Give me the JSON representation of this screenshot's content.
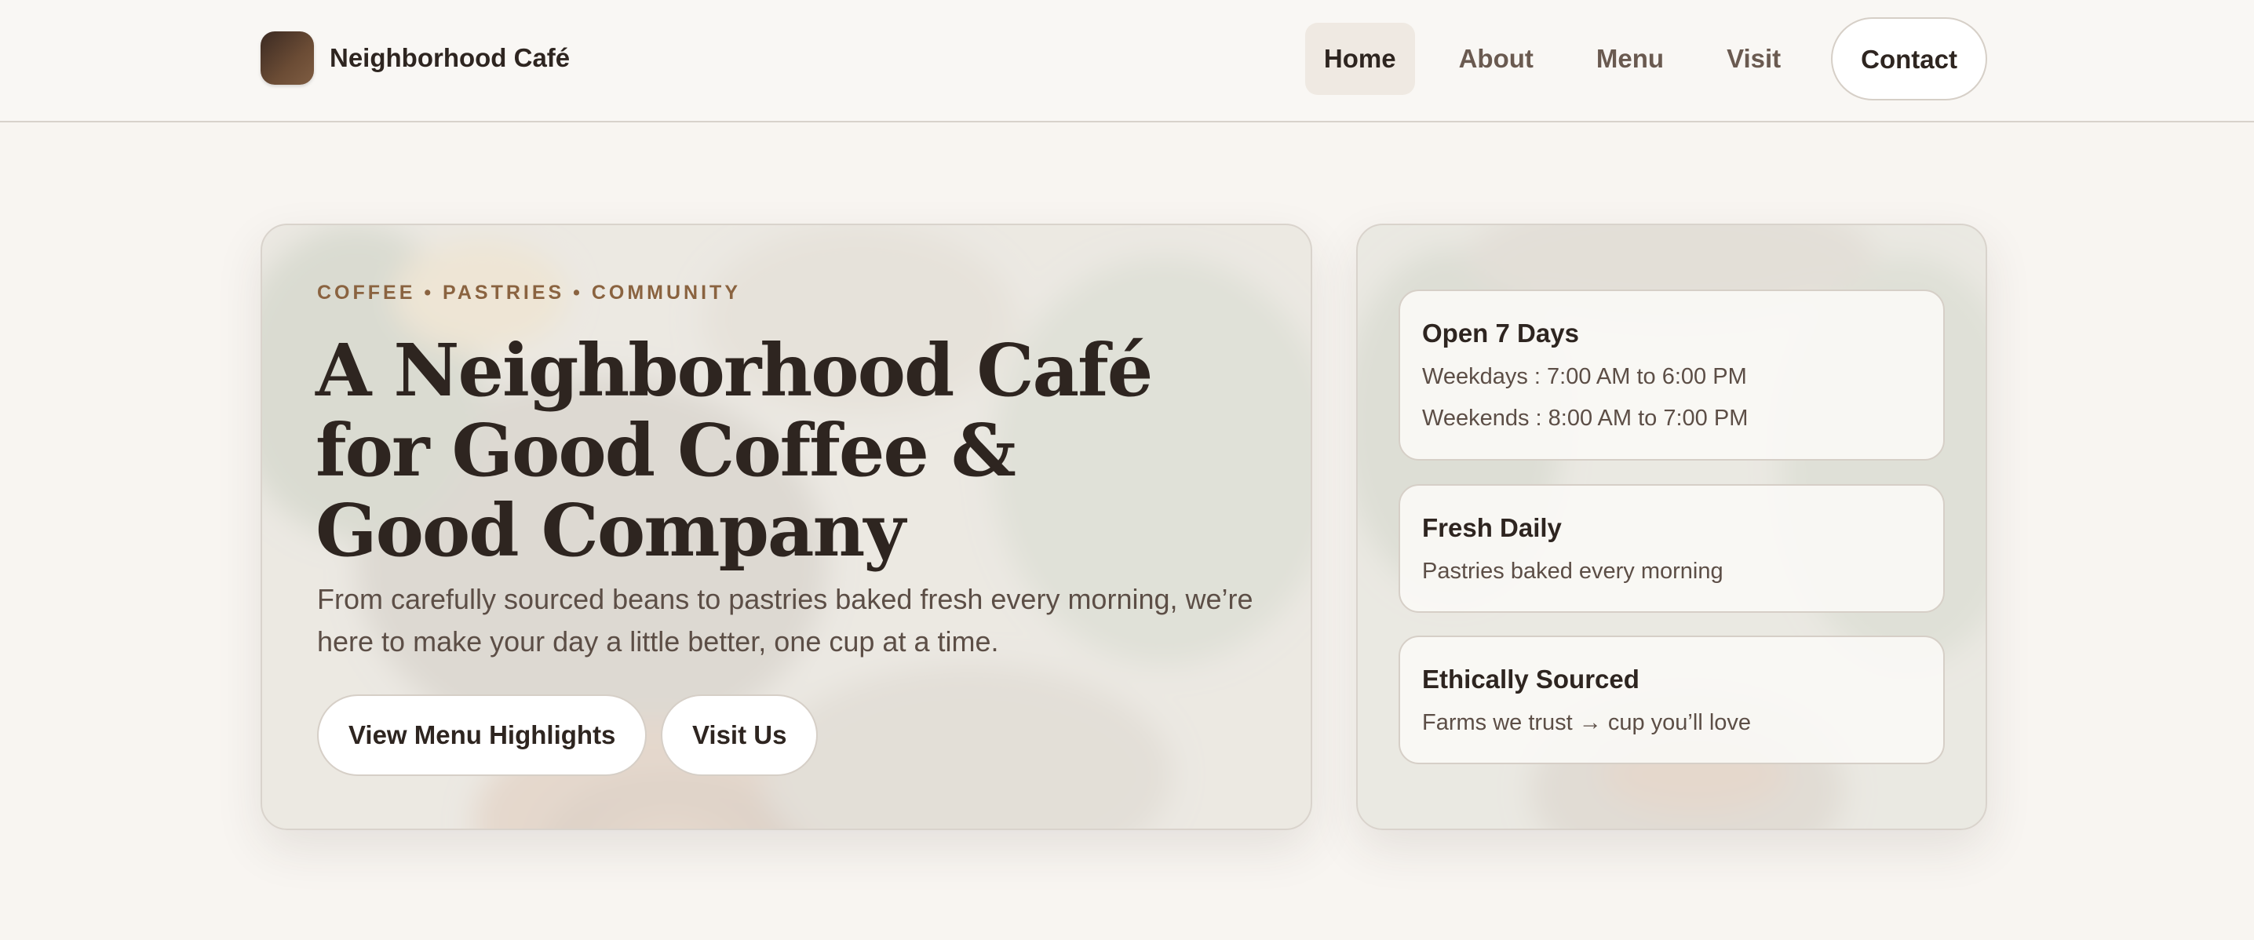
{
  "header": {
    "brand_name": "Neighborhood Café",
    "nav": [
      "Home",
      "About",
      "Menu",
      "Visit"
    ],
    "active": "Home",
    "contact_label": "Contact"
  },
  "hero": {
    "eyebrow": "COFFEE • PASTRIES • COMMUNITY",
    "headline": "A Neighborhood Café for Good Coffee & Good Company",
    "subtext": "From carefully sourced beans to pastries baked fresh every morning, we’re here to make your day a little better, one cup at a time.",
    "primary_button": "View Menu Highlights",
    "secondary_button": "Visit Us"
  },
  "info_cards": [
    {
      "title": "Open 7 Days",
      "lines": [
        "Weekdays : 7:00 AM to 6:00 PM",
        "Weekends : 8:00 AM to 7:00 PM"
      ]
    },
    {
      "title": "Fresh Daily",
      "lines": [
        "Pastries baked every morning"
      ]
    },
    {
      "title": "Ethically Sourced",
      "lines": [
        "Farms we trust → cup you’ll love"
      ]
    }
  ],
  "colors": {
    "background": "#f8f5f1",
    "accent": "#8a6340",
    "text": "#2e2520",
    "muted": "#5c4e46"
  }
}
